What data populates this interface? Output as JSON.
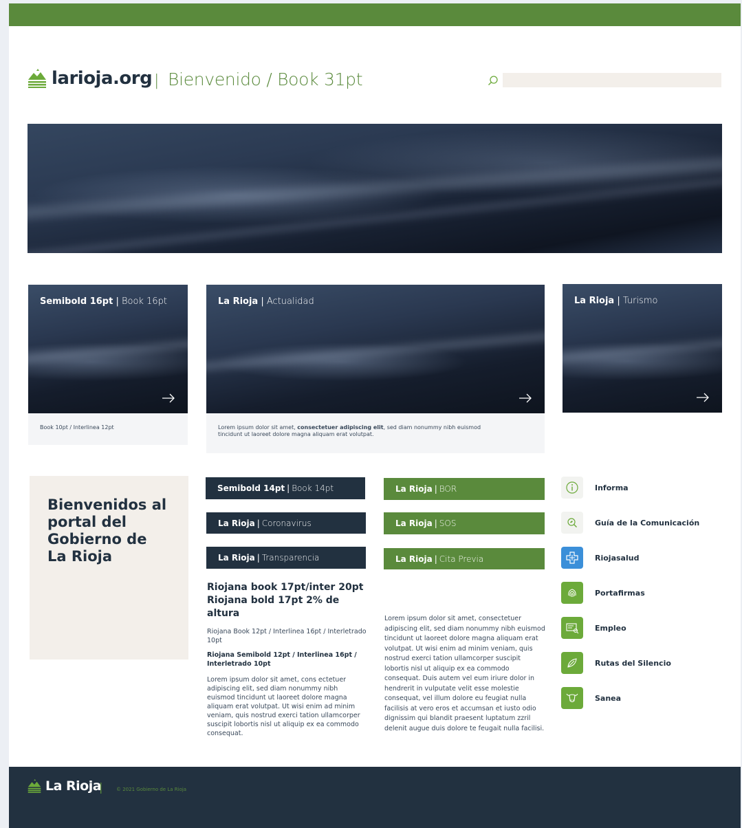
{
  "brand": {
    "logo_text": "larioja.org",
    "accent_color": "#5a8a3c",
    "dark_color": "#223140"
  },
  "header": {
    "title": "Bienvenido / Book 31pt",
    "separator": "|",
    "search_placeholder": ""
  },
  "cards": [
    {
      "title_bold": "Semibold 16pt",
      "title_sep": "|",
      "title_light": "Book 16pt",
      "foot": "Book 10pt / Interlinea 12pt"
    },
    {
      "title_bold": "La Rioja",
      "title_sep": "|",
      "title_light": "Actualidad",
      "foot_plain_1": "Lorem ipsum dolor sit amet, ",
      "foot_bold": "consectetuer adipiscing elit",
      "foot_plain_2": ", sed diam nonummy nibh euismod tincidunt ut laoreet dolore magna aliquam erat volutpat."
    },
    {
      "title_bold": "La Rioja",
      "title_sep": "|",
      "title_light": "Turismo"
    }
  ],
  "welcome": {
    "heading": "Bienvenidos al portal del Gobierno de La Rioja"
  },
  "dark_bars": [
    {
      "bold": "Semibold 14pt",
      "sep": "|",
      "light": "Book 14pt"
    },
    {
      "bold": "La Rioja",
      "sep": "|",
      "light": "Coronavirus"
    },
    {
      "bold": "La Rioja",
      "sep": "|",
      "light": "Transparencia"
    }
  ],
  "green_bars": [
    {
      "bold": "La Rioja",
      "sep": "|",
      "light": "BOR"
    },
    {
      "bold": "La Rioja",
      "sep": "|",
      "light": "SOS"
    },
    {
      "bold": "La Rioja",
      "sep": "|",
      "light": "Cita Previa"
    }
  ],
  "typography": {
    "heading": "Riojana book 17pt/inter 20pt Riojana bold 17pt 2% de altura",
    "line1": "Riojana Book 12pt / Interlinea 16pt / Interletrado 10pt",
    "line2": "Riojana Semibold 12pt / Interlinea 16pt / Interletrado 10pt",
    "lorem": "Lorem ipsum dolor sit amet, cons ectetuer adipiscing elit, sed diam nonummy nibh euismod tincidunt ut laoreet dolore magna aliquam erat volutpat. Ut wisi enim ad minim veniam, quis nostrud exerci tation ullamcorper suscipit lobortis nisl ut aliquip ex ea commodo consequat."
  },
  "lorem_column": "Lorem ipsum dolor sit amet, consectetuer adipiscing elit, sed diam nonummy nibh euismod tincidunt ut laoreet dolore magna aliquam erat volutpat. Ut wisi enim ad minim veniam, quis nostrud exerci tation ullamcorper suscipit lobortis nisl ut aliquip ex ea commodo consequat. Duis autem vel eum iriure dolor in hendrerit in vulputate velit esse molestie consequat, vel illum dolore eu feugiat nulla facilisis at vero eros et accumsan et iusto odio dignissim qui blandit praesent luptatum zzril delenit augue duis dolore te feugait nulla facilisi.",
  "services": [
    {
      "label": "Informa",
      "icon": "info-icon",
      "style": "gray"
    },
    {
      "label": "Guía de la Comunicación",
      "icon": "magnifier-leaf-icon",
      "style": "gray"
    },
    {
      "label": "Riojasalud",
      "icon": "health-cross-icon",
      "style": "blue"
    },
    {
      "label": "Portafirmas",
      "icon": "fingerprint-icon",
      "style": "green"
    },
    {
      "label": "Empleo",
      "icon": "job-search-icon",
      "style": "green"
    },
    {
      "label": "Rutas del Silencio",
      "icon": "route-leaf-icon",
      "style": "green"
    },
    {
      "label": "Sanea",
      "icon": "cow-icon",
      "style": "green"
    }
  ],
  "footer": {
    "logo_text": "La Rioja",
    "separator": "|",
    "copyright": "© 2021 Gobierno de La Rioja"
  }
}
